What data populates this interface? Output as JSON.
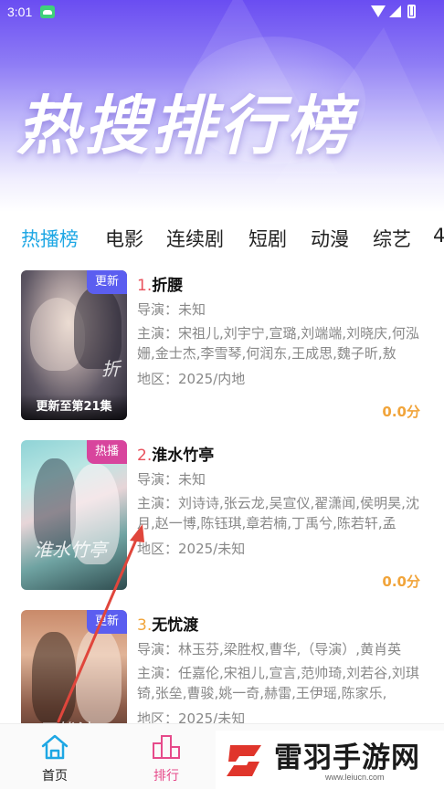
{
  "status_bar": {
    "time": "3:01"
  },
  "hero": {
    "title": "热搜排行榜"
  },
  "tabs": [
    {
      "label": "热播榜",
      "active": true
    },
    {
      "label": "电影"
    },
    {
      "label": "连续剧"
    },
    {
      "label": "短剧"
    },
    {
      "label": "动漫"
    },
    {
      "label": "综艺"
    },
    {
      "label": "4"
    }
  ],
  "items": [
    {
      "rank": "1.",
      "title": "折腰",
      "director": "导演：未知",
      "cast": "主演：宋祖儿,刘宇宁,宣璐,刘端端,刘晓庆,何泓姗,金士杰,李雪琴,何润东,王成思,魏子昕,敖",
      "region": "地区：2025/内地",
      "score": "0.0分",
      "badge": "更新",
      "badge_color": "#5b5ef0",
      "caption": "更新至第21集",
      "rank_color": "#e8505b"
    },
    {
      "rank": "2.",
      "title": "淮水竹亭",
      "director": "导演：未知",
      "cast": "主演：刘诗诗,张云龙,吴宣仪,翟潇闻,侯明昊,沈月,赵一博,陈钰琪,章若楠,丁禹兮,陈若轩,孟",
      "region": "地区：2025/未知",
      "score": "0.0分",
      "badge": "热播",
      "badge_color": "#d8459d",
      "rank_color": "#e8505b"
    },
    {
      "rank": "3.",
      "title": "无忧渡",
      "director": "导演：林玉芬,梁胜权,曹华,（导演）,黄肖英",
      "cast": "主演：任嘉伦,宋祖儿,宣言,范帅琦,刘若谷,刘琪锜,张垒,曹骏,姚一奇,赫雷,王伊瑶,陈家乐,",
      "region": "地区：2025/未知",
      "badge": "更新",
      "badge_color": "#5b5ef0",
      "rank_color": "#f1a43a"
    }
  ],
  "bottom_nav": [
    {
      "label": "首页",
      "active": true,
      "icon": "home-icon"
    },
    {
      "label": "排行",
      "active": false,
      "icon": "ranking-icon"
    }
  ],
  "watermark": {
    "text": "雷羽手游网",
    "url": "www.leiucn.com"
  },
  "colors": {
    "accent": "#1ea7e4",
    "pink": "#e64a8a",
    "score": "#f1a43a"
  }
}
